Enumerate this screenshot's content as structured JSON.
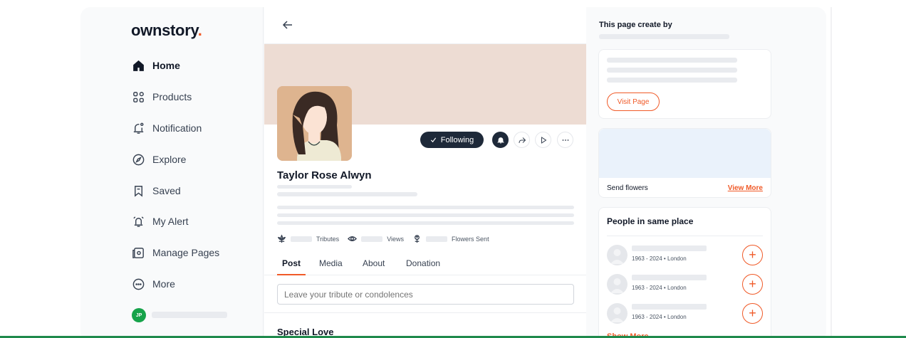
{
  "app": {
    "logo_text": "ownstory",
    "logo_dot": ".",
    "brand_color": "#f05a28"
  },
  "sidebar": {
    "items": [
      {
        "label": "Home",
        "icon": "home-icon"
      },
      {
        "label": "Products",
        "icon": "grid-icon"
      },
      {
        "label": "Notification",
        "icon": "bell-icon"
      },
      {
        "label": "Explore",
        "icon": "compass-icon"
      },
      {
        "label": "Saved",
        "icon": "bookmark-icon"
      },
      {
        "label": "My Alert",
        "icon": "alarm-icon"
      },
      {
        "label": "Manage Pages",
        "icon": "manage-pages-icon"
      },
      {
        "label": "More",
        "icon": "more-circle-icon"
      }
    ],
    "user_initials": "JP"
  },
  "profile": {
    "name": "Taylor Rose Alwyn",
    "follow_label": "Following",
    "stats": [
      {
        "label": "Tributes",
        "icon": "lotus-icon"
      },
      {
        "label": "Views",
        "icon": "eye-icon"
      },
      {
        "label": "Flowers Sent",
        "icon": "flower-icon"
      }
    ],
    "tabs": [
      {
        "label": "Post"
      },
      {
        "label": "Media"
      },
      {
        "label": "About"
      },
      {
        "label": "Donation"
      }
    ],
    "tribute_placeholder": "Leave your tribute or condolences",
    "section_title": "Special Love"
  },
  "right": {
    "created_by_title": "This page create by",
    "visit_label": "Visit Page",
    "send_flowers_label": "Send flowers",
    "view_more_label": "View More",
    "people_title": "People in same place",
    "people": [
      {
        "meta": "1963 - 2024 • London"
      },
      {
        "meta": "1963 - 2024 • London"
      },
      {
        "meta": "1963 - 2024 • London"
      }
    ],
    "show_more_label": "Show More"
  }
}
